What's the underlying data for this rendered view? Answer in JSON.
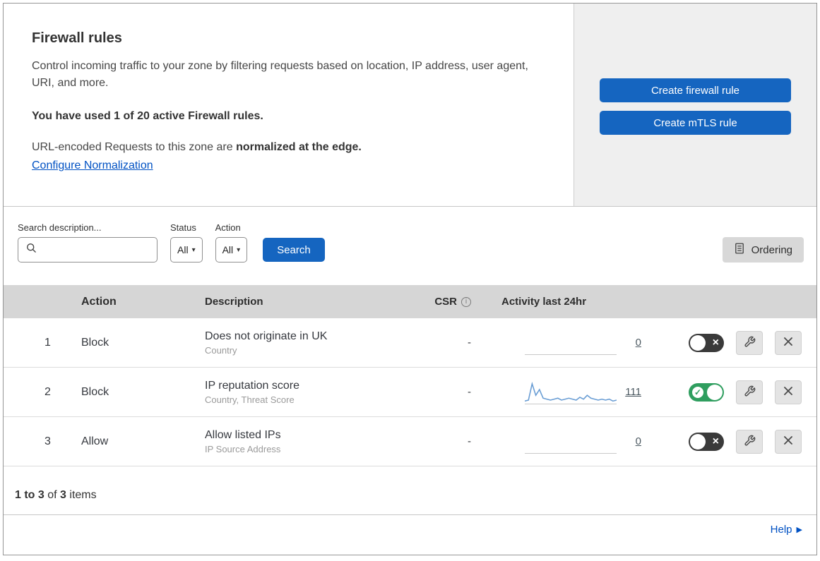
{
  "colors": {
    "primary": "#1565c0",
    "link": "#0051c3",
    "toggle-on": "#2f9e5f",
    "toggle-off": "#3a3a3a"
  },
  "header": {
    "title": "Firewall rules",
    "description": "Control incoming traffic to your zone by filtering requests based on location, IP address, user agent, URI, and more.",
    "usage": "You have used 1 of 20 active Firewall rules.",
    "normalization_prefix": "URL-encoded Requests to this zone are ",
    "normalization_bold": "normalized at the edge.",
    "normalization_link": "Configure Normalization",
    "create_firewall_button": "Create firewall rule",
    "create_mtls_button": "Create mTLS rule"
  },
  "toolbar": {
    "search_label": "Search description...",
    "status_label": "Status",
    "status_value": "All",
    "action_label": "Action",
    "action_value": "All",
    "search_button": "Search",
    "ordering_button": "Ordering"
  },
  "table": {
    "headers": {
      "action": "Action",
      "description": "Description",
      "csr": "CSR",
      "activity": "Activity last 24hr"
    },
    "rows": [
      {
        "num": "1",
        "action": "Block",
        "description": "Does not originate in UK",
        "criteria": "Country",
        "csr": "-",
        "activity_count": "0",
        "enabled": false,
        "sparkline": []
      },
      {
        "num": "2",
        "action": "Block",
        "description": "IP reputation score",
        "criteria": "Country, Threat Score",
        "csr": "-",
        "activity_count": "111",
        "enabled": true,
        "sparkline": [
          2,
          3,
          20,
          8,
          14,
          5,
          4,
          3,
          4,
          5,
          3,
          4,
          5,
          4,
          3,
          6,
          4,
          8,
          5,
          4,
          3,
          4,
          3,
          4,
          2,
          3
        ]
      },
      {
        "num": "3",
        "action": "Allow",
        "description": "Allow listed IPs",
        "criteria": "IP Source Address",
        "csr": "-",
        "activity_count": "0",
        "enabled": false,
        "sparkline": []
      }
    ]
  },
  "footer": {
    "range": "1 to 3",
    "of_text": " of ",
    "total": "3",
    "items_text": " items",
    "help": "Help"
  }
}
